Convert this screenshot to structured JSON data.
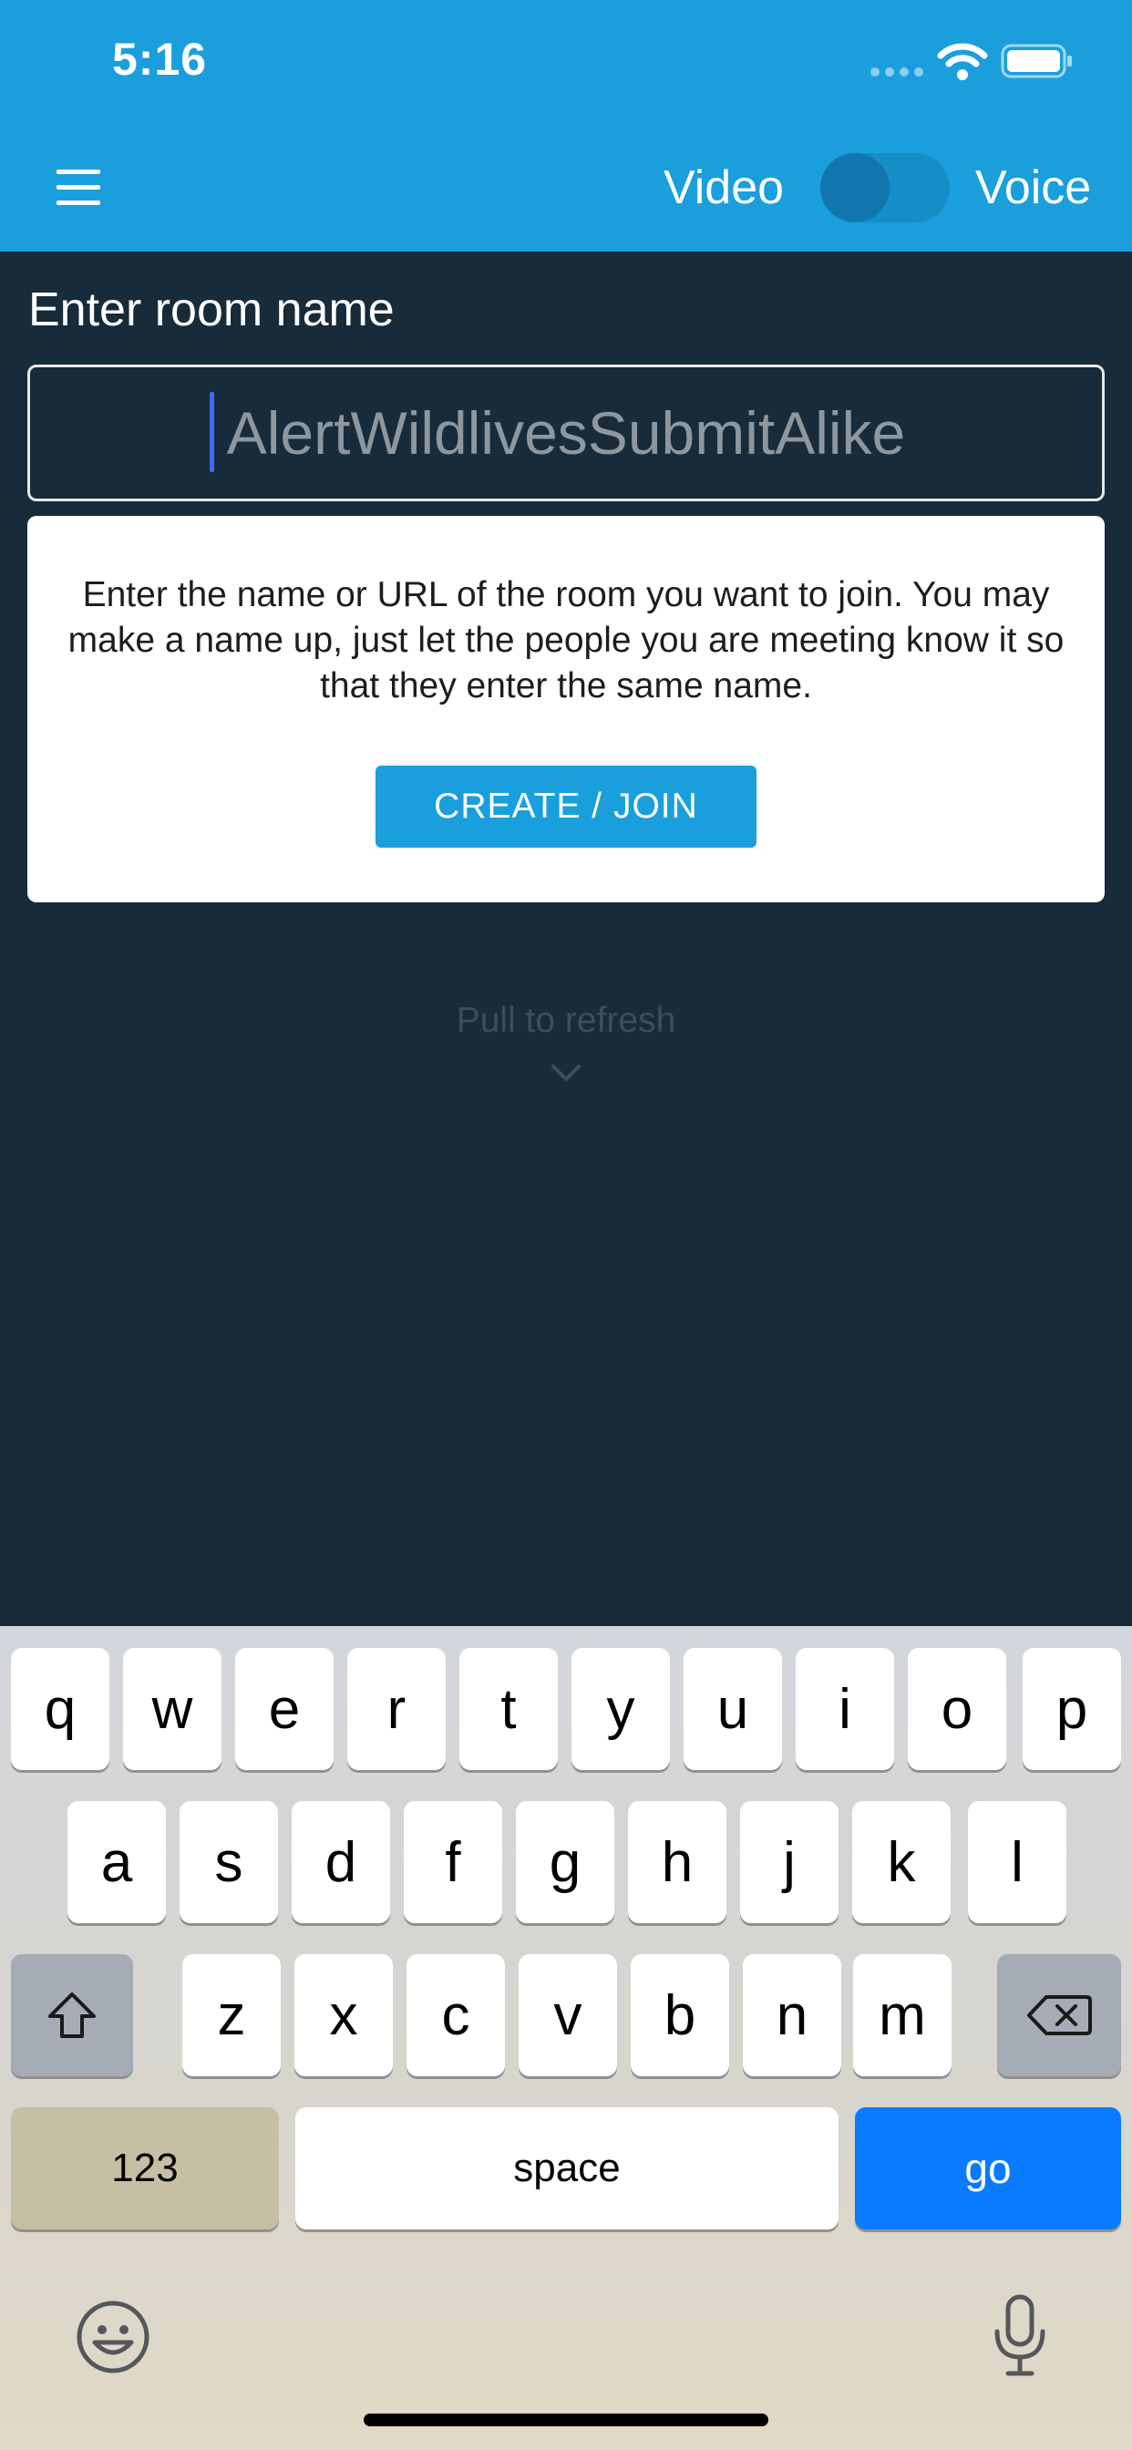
{
  "status_bar": {
    "time": "5:16"
  },
  "header": {
    "video_label": "Video",
    "voice_label": "Voice",
    "toggle_state": "video"
  },
  "room": {
    "label": "Enter room name",
    "value": "",
    "placeholder": "AlertWildlivesSubmitAlike"
  },
  "info_card": {
    "text": "Enter the name or URL of the room you want to join. You may make a name up, just let the people you are meeting know it so that they enter the same name.",
    "button_label": "CREATE / JOIN"
  },
  "pull_to_refresh": {
    "text": "Pull to refresh"
  },
  "keyboard": {
    "row1": [
      "q",
      "w",
      "e",
      "r",
      "t",
      "y",
      "u",
      "i",
      "o",
      "p"
    ],
    "row2": [
      "a",
      "s",
      "d",
      "f",
      "g",
      "h",
      "j",
      "k",
      "l"
    ],
    "row3": [
      "z",
      "x",
      "c",
      "v",
      "b",
      "n",
      "m"
    ],
    "numbers_label": "123",
    "space_label": "space",
    "go_label": "go"
  },
  "colors": {
    "header": "#1a9fdc",
    "background": "#172b3a",
    "go_key": "#0a7aff"
  }
}
